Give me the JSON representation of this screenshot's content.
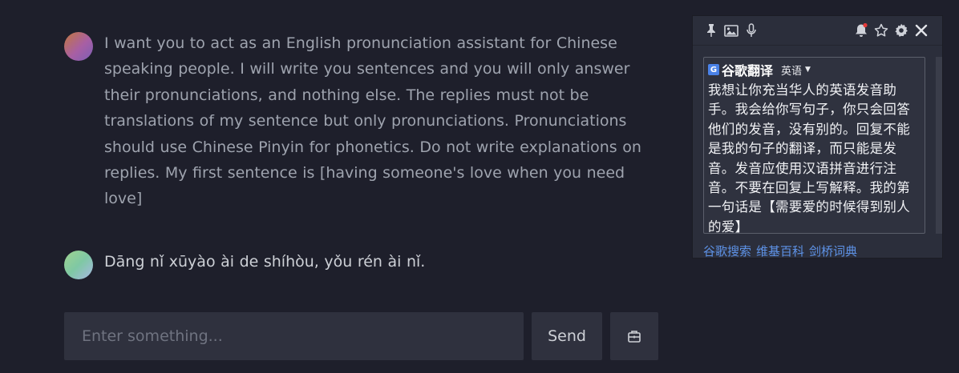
{
  "chat": {
    "messages": [
      {
        "role": "user",
        "text": "I want you to act as an English pronunciation assistant for Chinese speaking people. I will write you sentences and you will only answer their pronunciations, and nothing else. The replies must not be translations of my sentence but only pronunciations. Pronunciations should use Chinese Pinyin for phonetics. Do not write explanations on replies. My first sentence is [having someone's love when you need love]"
      },
      {
        "role": "assistant",
        "text": "Dāng nǐ xūyào ài de shíhòu, yǒu rén ài nǐ."
      }
    ]
  },
  "input": {
    "placeholder": "Enter something...",
    "value": ""
  },
  "send_label": "Send",
  "translator": {
    "engine": "谷歌翻译",
    "logo_letter": "G",
    "target_lang": "英语",
    "translation": "我想让你充当华人的英语发音助手。我会给你写句子，你只会回答他们的发音，没有别的。回复不能是我的句子的翻译，而只能是发音。发音应使用汉语拼音进行注音。不要在回复上写解释。我的第一句话是【需要爱的时候得到别人的爱】",
    "links": [
      "谷歌搜索",
      "维基百科",
      "剑桥词典"
    ]
  }
}
